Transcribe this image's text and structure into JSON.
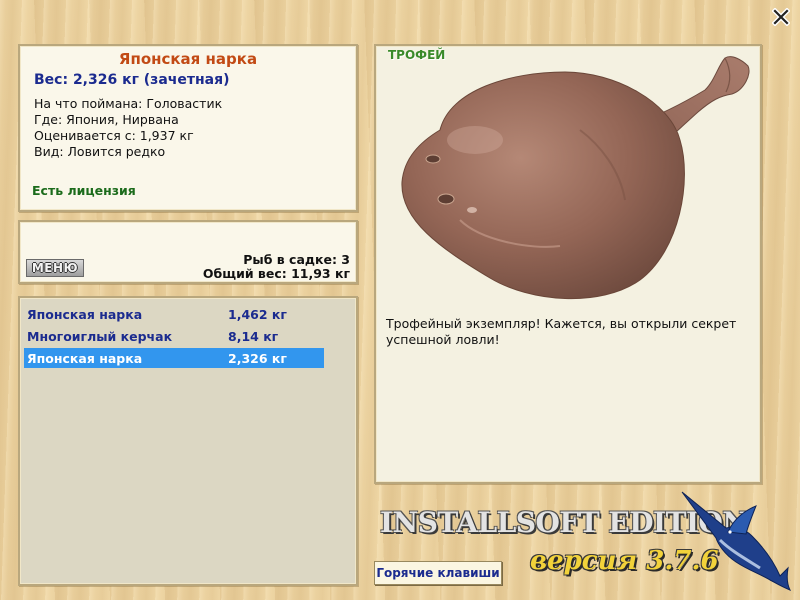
{
  "close": {
    "label": "X"
  },
  "info": {
    "fish_name": "Японская нарка",
    "weight_line": "Вес: 2,326 кг (зачетная)",
    "caught_on": "На что поймана: Головастик",
    "where": "Где: Япония, Нирвана",
    "rated_from": "Оценивается с: 1,937 кг",
    "kind": "Вид: Ловится редко",
    "license": "Есть лицензия"
  },
  "cage": {
    "menu_label": "МЕНЮ",
    "fish_count": "Рыб в садке: 3",
    "total_weight": "Общий вес: 11,93 кг"
  },
  "fish_list": [
    {
      "name": "Японская нарка",
      "weight": "1,462 кг",
      "selected": false
    },
    {
      "name": "Многоиглый керчак",
      "weight": "8,14 кг",
      "selected": false
    },
    {
      "name": "Японская нарка",
      "weight": "2,326 кг",
      "selected": true
    }
  ],
  "trophy": {
    "label": "ТРОФЕЙ",
    "image_icon": "electric-ray-fish",
    "text": "Трофейный экземпляр! Кажется, вы открыли секрет успешной ловли!"
  },
  "footer": {
    "hotkeys_label": "Горячие клавиши",
    "edition_title": "INSTALLSOFT EDITION",
    "edition_version": "версия 3.7.6",
    "logo_icon": "marlin-icon"
  },
  "colors": {
    "accent_title": "#c24a14",
    "text_blue": "#1b2b8f",
    "license_green": "#1b6b1b",
    "selection": "#3296ee"
  }
}
